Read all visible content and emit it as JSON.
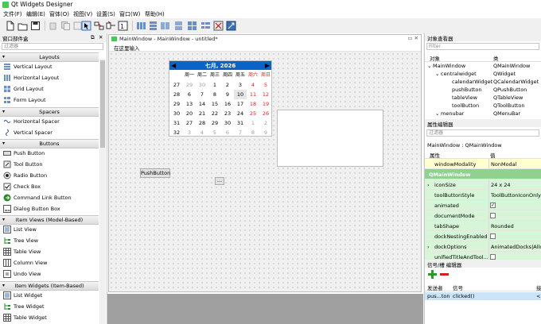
{
  "app": {
    "title": "Qt Widgets Designer"
  },
  "menubar": {
    "items": [
      "文件(F)",
      "编辑(E)",
      "窗体(O)",
      "视图(V)",
      "设置(S)",
      "窗口(W)",
      "帮助(H)"
    ]
  },
  "toolbar": {
    "icons": [
      "new-file-icon",
      "open-file-icon",
      "save-icon",
      "cut-icon",
      "copy-icon",
      "paste-icon",
      "edit-widgets-icon",
      "edit-signals-icon",
      "edit-buddies-icon",
      "edit-tab-order-icon",
      "layout-horizontal-icon",
      "layout-vertical-icon",
      "layout-splitter-h-icon",
      "layout-splitter-v-icon",
      "layout-grid-icon",
      "layout-form-icon",
      "break-layout-icon",
      "adjust-size-icon"
    ]
  },
  "widget_box": {
    "title": "窗口部件盒",
    "filter_placeholder": "过滤器",
    "sections": [
      {
        "name": "Layouts",
        "items": [
          "Vertical Layout",
          "Horizontal Layout",
          "Grid Layout",
          "Form Layout"
        ]
      },
      {
        "name": "Spacers",
        "items": [
          "Horizontal Spacer",
          "Vertical Spacer"
        ]
      },
      {
        "name": "Buttons",
        "items": [
          "Push Button",
          "Tool Button",
          "Radio Button",
          "Check Box",
          "Command Link Button",
          "Dialog Button Box"
        ]
      },
      {
        "name": "Item Views (Model-Based)",
        "items": [
          "List View",
          "Tree View",
          "Table View",
          "Column View",
          "Undo View"
        ]
      },
      {
        "name": "Item Widgets (Item-Based)",
        "items": [
          "List Widget",
          "Tree Widget",
          "Table Widget"
        ]
      }
    ]
  },
  "form": {
    "window_title": "MainWindow - MainWindow - untitled*",
    "menu_placeholder": "在这里输入",
    "push_button": "PushButton",
    "tool_button": "...",
    "calendar": {
      "title": "七月,  2026",
      "weekdays": [
        "周一",
        "周二",
        "周三",
        "周四",
        "周五",
        "周六",
        "周日"
      ],
      "weeks": [
        [
          "27",
          "29",
          "30",
          "1",
          "2",
          "3",
          "4",
          "5"
        ],
        [
          "28",
          "6",
          "7",
          "8",
          "9",
          "10",
          "11",
          "12"
        ],
        [
          "29",
          "13",
          "14",
          "15",
          "16",
          "17",
          "18",
          "19"
        ],
        [
          "30",
          "20",
          "21",
          "22",
          "23",
          "24",
          "25",
          "26"
        ],
        [
          "31",
          "27",
          "28",
          "29",
          "30",
          "31",
          "1",
          "2"
        ],
        [
          "32",
          "3",
          "4",
          "5",
          "6",
          "7",
          "8",
          "9"
        ]
      ]
    }
  },
  "object_inspector": {
    "title": "对象查看器",
    "filter_placeholder": "Filter",
    "columns": [
      "对象",
      "类"
    ],
    "rows": [
      {
        "object": "MainWindow",
        "class": "QMainWindow",
        "indent": 0
      },
      {
        "object": "centralwidget",
        "class": "QWidget",
        "indent": 1
      },
      {
        "object": "calendarWidget",
        "class": "QCalendarWidget",
        "indent": 2
      },
      {
        "object": "pushButton",
        "class": "QPushButton",
        "indent": 2
      },
      {
        "object": "tableView",
        "class": "QTableView",
        "indent": 2
      },
      {
        "object": "toolButton",
        "class": "QToolButton",
        "indent": 2
      },
      {
        "object": "menubar",
        "class": "QMenuBar",
        "indent": 1
      }
    ]
  },
  "property_editor": {
    "title": "属性编辑器",
    "filter_placeholder": "过滤器",
    "object_label": "MainWindow : QMainWindow",
    "columns": [
      "属性",
      "值"
    ],
    "rows": [
      {
        "name": "windowModality",
        "value": "NonModal",
        "kind": "text"
      },
      {
        "name": "QMainWindow",
        "value": "",
        "kind": "group"
      },
      {
        "name": "iconSize",
        "value": "24 x 24",
        "kind": "text",
        "expand": true
      },
      {
        "name": "toolButtonStyle",
        "value": "ToolButtonIconOnly",
        "kind": "text"
      },
      {
        "name": "animated",
        "value": "✓",
        "kind": "check"
      },
      {
        "name": "documentMode",
        "value": "",
        "kind": "check"
      },
      {
        "name": "tabShape",
        "value": "Rounded",
        "kind": "text"
      },
      {
        "name": "dockNestingEnabled",
        "value": "",
        "kind": "check"
      },
      {
        "name": "dockOptions",
        "value": "AnimatedDocks|Allow",
        "kind": "text",
        "expand": true
      },
      {
        "name": "unifiedTitleAndTool...",
        "value": "",
        "kind": "check"
      }
    ]
  },
  "signal_slot_editor": {
    "title": "信号/槽 编辑器",
    "columns": [
      "发送者",
      "信号",
      "接"
    ],
    "rows": [
      {
        "sender": "pus...ton",
        "signal": "clicked()",
        "receiver": "<"
      }
    ]
  },
  "colors": {
    "accent": "#0a64c8",
    "weekend": "#e02020",
    "group": "#8fd18f",
    "prop_yellow": "#ffffd0",
    "prop_green": "#d7f5d7",
    "selected": "#cce4f7"
  }
}
